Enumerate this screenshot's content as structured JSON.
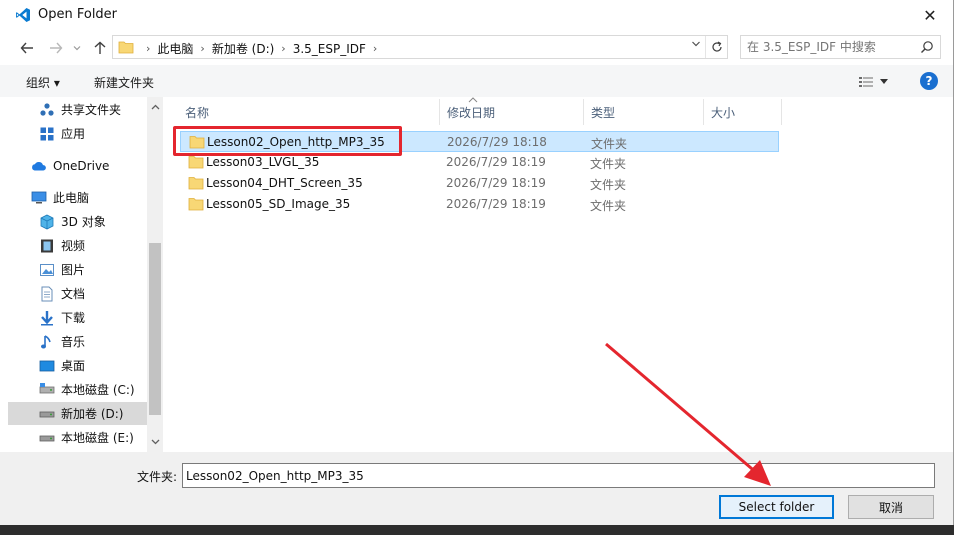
{
  "window": {
    "title": "Open Folder",
    "close_glyph": "✕"
  },
  "address": {
    "crumbs": [
      "此电脑",
      "新加卷 (D:)",
      "3.5_ESP_IDF"
    ],
    "separator": "›"
  },
  "search": {
    "placeholder": "在 3.5_ESP_IDF 中搜索"
  },
  "toolbar": {
    "organize_label": "组织 ▾",
    "new_folder_label": "新建文件夹",
    "help_label": "?"
  },
  "sidebar": {
    "items": [
      {
        "label": "共享文件夹",
        "icon": "share-icon"
      },
      {
        "label": "应用",
        "icon": "apps-icon"
      },
      {
        "label": "OneDrive",
        "icon": "onedrive-icon"
      },
      {
        "label": "此电脑",
        "icon": "computer-icon"
      },
      {
        "label": "3D 对象",
        "icon": "3d-objects-icon"
      },
      {
        "label": "视频",
        "icon": "videos-icon"
      },
      {
        "label": "图片",
        "icon": "pictures-icon"
      },
      {
        "label": "文档",
        "icon": "documents-icon"
      },
      {
        "label": "下载",
        "icon": "downloads-icon"
      },
      {
        "label": "音乐",
        "icon": "music-icon"
      },
      {
        "label": "桌面",
        "icon": "desktop-icon"
      },
      {
        "label": "本地磁盘 (C:)",
        "icon": "drive-icon"
      },
      {
        "label": "新加卷 (D:)",
        "icon": "drive-icon",
        "selected": true
      },
      {
        "label": "本地磁盘 (E:)",
        "icon": "drive-icon"
      }
    ]
  },
  "columns": {
    "name": "名称",
    "modified": "修改日期",
    "type": "类型",
    "size": "大小"
  },
  "files": [
    {
      "name": "Lesson02_Open_http_MP3_35",
      "modified": "2026/7/29 18:18",
      "type": "文件夹",
      "selected": true
    },
    {
      "name": "Lesson03_LVGL_35",
      "modified": "2026/7/29 18:19",
      "type": "文件夹"
    },
    {
      "name": "Lesson04_DHT_Screen_35",
      "modified": "2026/7/29 18:19",
      "type": "文件夹"
    },
    {
      "name": "Lesson05_SD_Image_35",
      "modified": "2026/7/29 18:19",
      "type": "文件夹"
    }
  ],
  "footer": {
    "folder_label": "文件夹:",
    "folder_value": "Lesson02_Open_http_MP3_35",
    "select_label": "Select folder",
    "cancel_label": "取消"
  },
  "colors": {
    "accent": "#0078d7",
    "annotation": "#e4262e",
    "selection": "#cce8ff"
  }
}
